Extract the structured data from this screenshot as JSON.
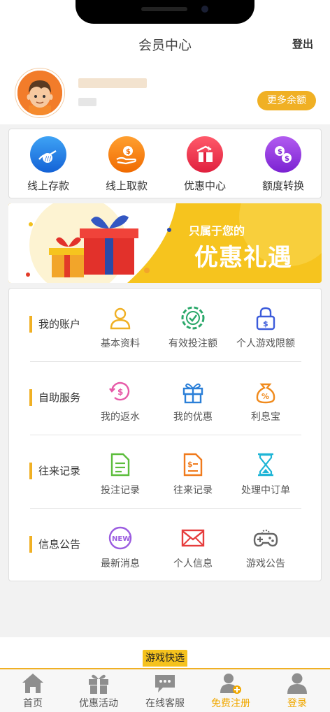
{
  "header": {
    "title": "会员中心",
    "logout_label": "登出"
  },
  "profile": {
    "more_balance_label": "更多余额"
  },
  "quick_actions": [
    {
      "label": "线上存款",
      "icon": "deposit-card-icon"
    },
    {
      "label": "线上取款",
      "icon": "withdraw-coin-icon"
    },
    {
      "label": "优惠中心",
      "icon": "promotion-ticket-icon"
    },
    {
      "label": "额度转换",
      "icon": "transfer-coins-icon"
    }
  ],
  "banner": {
    "line1": "只属于您的",
    "line2": "优惠礼遇"
  },
  "sections": [
    {
      "title": "我的账户",
      "items": [
        {
          "label": "基本资料",
          "icon": "user-icon"
        },
        {
          "label": "有效投注额",
          "icon": "chip-icon"
        },
        {
          "label": "个人游戏限额",
          "icon": "lock-icon"
        }
      ]
    },
    {
      "title": "自助服务",
      "items": [
        {
          "label": "我的返水",
          "icon": "rebate-icon"
        },
        {
          "label": "我的优惠",
          "icon": "gift-icon"
        },
        {
          "label": "利息宝",
          "icon": "money-bag-icon"
        }
      ]
    },
    {
      "title": "往来记录",
      "items": [
        {
          "label": "投注记录",
          "icon": "bet-record-icon"
        },
        {
          "label": "往来记录",
          "icon": "transaction-record-icon"
        },
        {
          "label": "处理中订单",
          "icon": "hourglass-icon"
        }
      ]
    },
    {
      "title": "信息公告",
      "items": [
        {
          "label": "最新消息",
          "icon": "new-badge-icon"
        },
        {
          "label": "个人信息",
          "icon": "mail-icon"
        },
        {
          "label": "游戏公告",
          "icon": "gamepad-icon"
        }
      ]
    }
  ],
  "games_shortcut": {
    "label": "游戏快选"
  },
  "tabbar": [
    {
      "label": "首页",
      "icon": "home-icon"
    },
    {
      "label": "优惠活动",
      "icon": "gift-icon"
    },
    {
      "label": "在线客服",
      "icon": "chat-icon"
    },
    {
      "label": "免费注册",
      "icon": "add-user-icon",
      "active": true
    },
    {
      "label": "登录",
      "icon": "user-icon",
      "active": true
    }
  ],
  "colors": {
    "accent": "#f0b024",
    "active_tab": "#f0a800",
    "background": "#f2f2f2"
  }
}
